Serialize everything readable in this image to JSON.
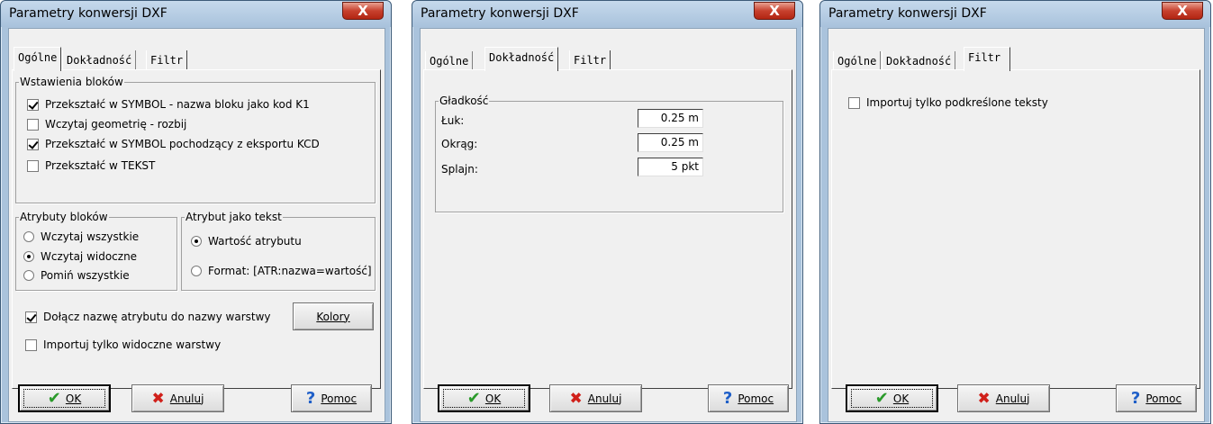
{
  "dialog_title": "Parametry konwersji DXF",
  "close_glyph": "X",
  "tabs": [
    "Ogólne",
    "Dokładność",
    "Filtr"
  ],
  "ogolne": {
    "group_blocks": "Wstawienia bloków",
    "cb1": "Przekształć w SYMBOL - nazwa bloku jako kod K1",
    "cb2": "Wczytaj geometrię - rozbij",
    "cb3": "Przekształć w SYMBOL pochodzący z eksportu KCD",
    "cb4": "Przekształć w TEKST",
    "group_attrs": "Atrybuty bloków",
    "r1": "Wczytaj wszystkie",
    "r2": "Wczytaj widoczne",
    "r3": "Pomiń wszystkie",
    "group_attrtext": "Atrybut jako tekst",
    "r4": "Wartość atrybutu",
    "r5": "Format: [ATR:nazwa=wartość]",
    "cb5": "Dołącz nazwę atrybutu do nazwy warstwy",
    "colors_btn": "Kolory",
    "cb6": "Importuj tylko widoczne warstwy"
  },
  "dokladnosc": {
    "group": "Gładkość",
    "luk_label": "Łuk:",
    "luk_value": "0.25 m",
    "okrag_label": "Okrąg:",
    "okrag_value": "0.25 m",
    "splajn_label": "Splajn:",
    "splajn_value": "5 pkt"
  },
  "filtr": {
    "cb": "Importuj tylko podkreślone teksty"
  },
  "buttons": {
    "ok": "OK",
    "cancel": "Anuluj",
    "help": "Pomoc"
  },
  "icons": {
    "ok": "check-icon",
    "cancel": "x-icon",
    "help": "question-icon"
  },
  "colors": {
    "title_bg": "#aac3dc",
    "close_bg": "#c7402d",
    "panel": "#f0f0f0"
  }
}
